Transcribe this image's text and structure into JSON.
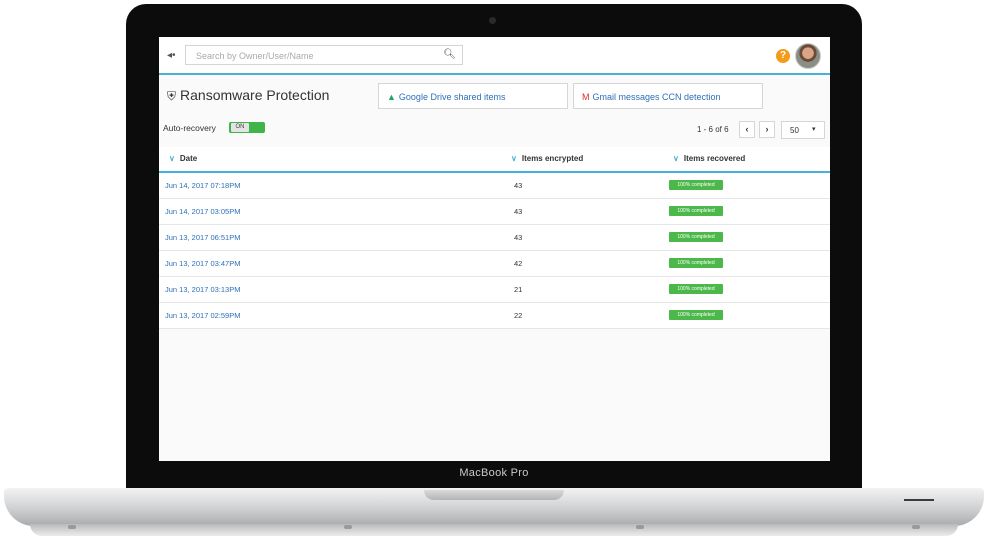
{
  "device": {
    "brand_label": "MacBook Pro"
  },
  "header": {
    "search_placeholder": "Search by Owner/User/Name",
    "help_label": "?"
  },
  "page": {
    "title": "Ransomware Protection",
    "tiles": [
      {
        "label": "Google Drive shared items",
        "icon": "google-drive-icon"
      },
      {
        "label": "Gmail messages CCN detection",
        "icon": "gmail-icon"
      }
    ],
    "auto_recovery": {
      "label": "Auto-recovery",
      "toggle_label": "ON"
    }
  },
  "pagination": {
    "range": "1 - 6 of 6",
    "prev": "‹",
    "next": "›",
    "per_page": "50",
    "caret": "▾"
  },
  "table": {
    "columns": [
      "Date",
      "Items encrypted",
      "Items recovered"
    ],
    "rows": [
      {
        "date": "Jun 14, 2017 07:18PM",
        "encrypted": "43",
        "recovered": "100% completed"
      },
      {
        "date": "Jun 14, 2017 03:05PM",
        "encrypted": "43",
        "recovered": "100% completed"
      },
      {
        "date": "Jun 13, 2017 06:51PM",
        "encrypted": "43",
        "recovered": "100% completed"
      },
      {
        "date": "Jun 13, 2017 03:47PM",
        "encrypted": "42",
        "recovered": "100% completed"
      },
      {
        "date": "Jun 13, 2017 03:13PM",
        "encrypted": "21",
        "recovered": "100% completed"
      },
      {
        "date": "Jun 13, 2017 02:59PM",
        "encrypted": "22",
        "recovered": "100% completed"
      }
    ]
  },
  "colors": {
    "accent": "#43b3d7",
    "link": "#2e6fb7",
    "success": "#4cb84a",
    "help": "#f39c1a"
  }
}
